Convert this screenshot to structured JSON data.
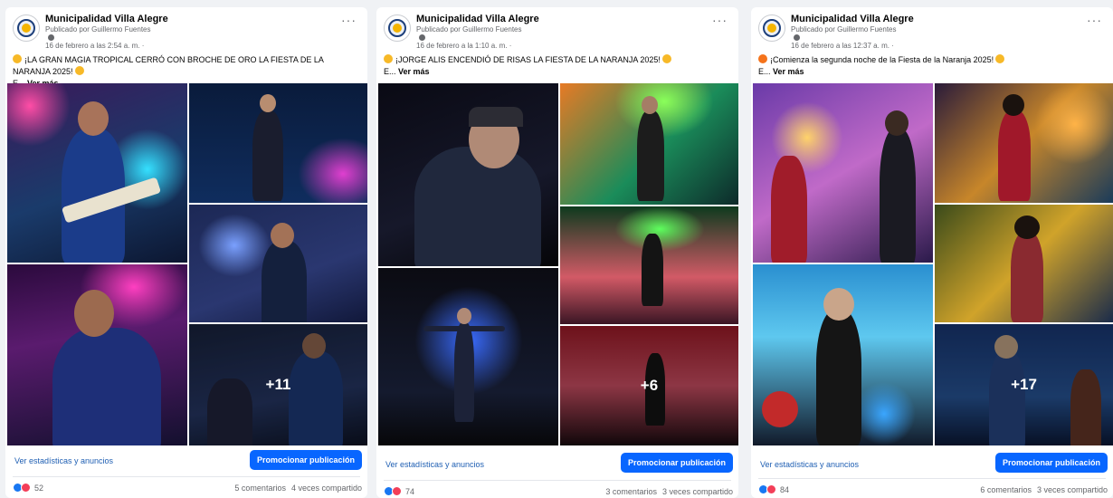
{
  "posts": [
    {
      "page_name": "Municipalidad Villa Alegre",
      "publisher": "Publicado por Guillermo Fuentes",
      "date": "16 de febrero a las 2:54 a. m. ·",
      "caption": "¡LA GRAN MAGIA TROPICAL CERRÓ CON BROCHE DE ORO LA FIESTA DE LA NARANJA 2025!",
      "caption_cont": "E...",
      "see_more": "Ver más",
      "more_photos": "+11",
      "stats_link": "Ver estadísticas y anuncios",
      "promote": "Promocionar publicación",
      "reaction_count": "52",
      "comments": "5 comentarios",
      "shares": "4 veces compartido"
    },
    {
      "page_name": "Municipalidad Villa Alegre",
      "publisher": "Publicado por Guillermo Fuentes",
      "date": "16 de febrero a la 1:10 a. m. ·",
      "caption": "¡JORGE ALIS ENCENDIÓ DE RISAS LA FIESTA DE LA NARANJA 2025!",
      "caption_cont": "E...",
      "see_more": "Ver más",
      "more_photos": "+6",
      "stats_link": "Ver estadísticas y anuncios",
      "promote": "Promocionar publicación",
      "reaction_count": "74",
      "comments": "3 comentarios",
      "shares": "3 veces compartido"
    },
    {
      "page_name": "Municipalidad Villa Alegre",
      "publisher": "Publicado por Guillermo Fuentes",
      "date": "16 de febrero a las 12:37 a. m. ·",
      "caption": "¡Comienza la segunda noche de la Fiesta de la Naranja 2025!",
      "caption_cont": "E...",
      "see_more": "Ver más",
      "more_photos": "+17",
      "stats_link": "Ver estadísticas y anuncios",
      "promote": "Promocionar publicación",
      "reaction_count": "84",
      "comments": "6 comentarios",
      "shares": "3 veces compartido"
    }
  ],
  "colors": {
    "promote_button": "#0866ff",
    "link": "#1f5fb3",
    "like": "#1877f2",
    "love": "#f33e58"
  }
}
